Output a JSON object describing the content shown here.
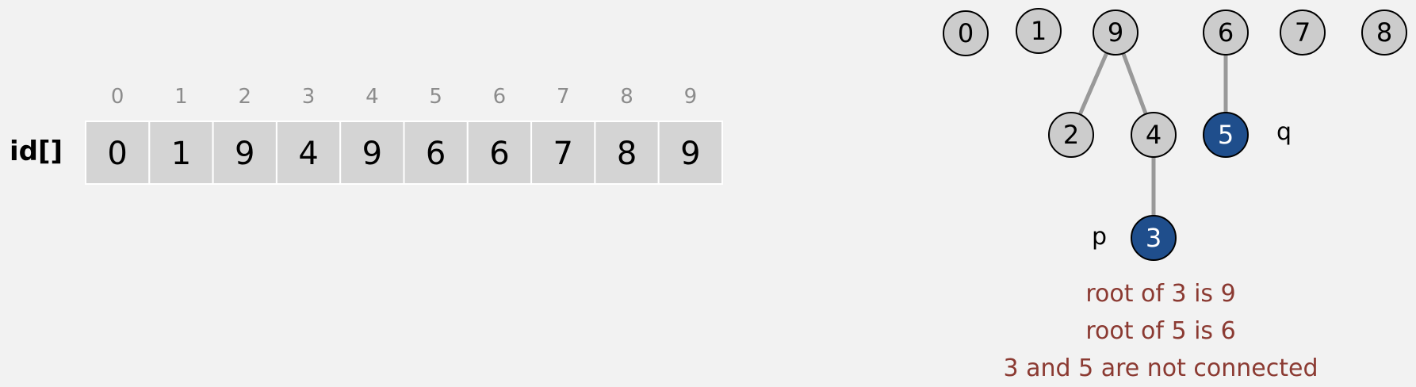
{
  "array": {
    "label": "id[]",
    "indices": [
      "0",
      "1",
      "2",
      "3",
      "4",
      "5",
      "6",
      "7",
      "8",
      "9"
    ],
    "values": [
      "0",
      "1",
      "9",
      "4",
      "9",
      "6",
      "6",
      "7",
      "8",
      "9"
    ]
  },
  "forest": {
    "nodes": [
      {
        "id": "0",
        "highlight": false
      },
      {
        "id": "1",
        "highlight": false
      },
      {
        "id": "9",
        "highlight": false
      },
      {
        "id": "6",
        "highlight": false
      },
      {
        "id": "7",
        "highlight": false
      },
      {
        "id": "8",
        "highlight": false
      },
      {
        "id": "2",
        "highlight": false
      },
      {
        "id": "4",
        "highlight": false
      },
      {
        "id": "5",
        "highlight": true
      },
      {
        "id": "3",
        "highlight": true
      }
    ],
    "edges": [
      [
        "9",
        "2"
      ],
      [
        "9",
        "4"
      ],
      [
        "4",
        "3"
      ],
      [
        "6",
        "5"
      ]
    ],
    "labels": {
      "p": "p",
      "q": "q"
    }
  },
  "messages": [
    "root of 3 is 9",
    "root of 5 is 6",
    "3 and 5 are not connected"
  ],
  "colors": {
    "background": "#f2f2f2",
    "node_fill": "#cccccc",
    "highlight_fill": "#1f4e8c",
    "edge": "#999999",
    "message": "#8b3a32",
    "index": "#8c8c8c",
    "cell": "#d4d4d4"
  }
}
